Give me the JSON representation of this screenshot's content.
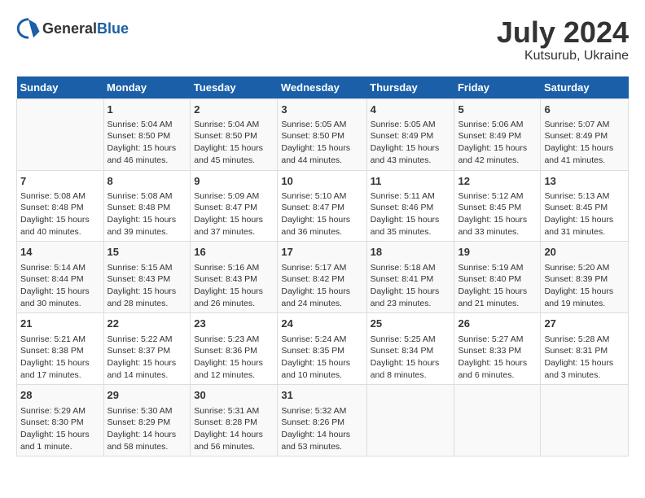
{
  "header": {
    "logo_general": "General",
    "logo_blue": "Blue",
    "month_year": "July 2024",
    "location": "Kutsurub, Ukraine"
  },
  "days_of_week": [
    "Sunday",
    "Monday",
    "Tuesday",
    "Wednesday",
    "Thursday",
    "Friday",
    "Saturday"
  ],
  "weeks": [
    [
      {
        "day": "",
        "info": ""
      },
      {
        "day": "1",
        "info": "Sunrise: 5:04 AM\nSunset: 8:50 PM\nDaylight: 15 hours\nand 46 minutes."
      },
      {
        "day": "2",
        "info": "Sunrise: 5:04 AM\nSunset: 8:50 PM\nDaylight: 15 hours\nand 45 minutes."
      },
      {
        "day": "3",
        "info": "Sunrise: 5:05 AM\nSunset: 8:50 PM\nDaylight: 15 hours\nand 44 minutes."
      },
      {
        "day": "4",
        "info": "Sunrise: 5:05 AM\nSunset: 8:49 PM\nDaylight: 15 hours\nand 43 minutes."
      },
      {
        "day": "5",
        "info": "Sunrise: 5:06 AM\nSunset: 8:49 PM\nDaylight: 15 hours\nand 42 minutes."
      },
      {
        "day": "6",
        "info": "Sunrise: 5:07 AM\nSunset: 8:49 PM\nDaylight: 15 hours\nand 41 minutes."
      }
    ],
    [
      {
        "day": "7",
        "info": "Sunrise: 5:08 AM\nSunset: 8:48 PM\nDaylight: 15 hours\nand 40 minutes."
      },
      {
        "day": "8",
        "info": "Sunrise: 5:08 AM\nSunset: 8:48 PM\nDaylight: 15 hours\nand 39 minutes."
      },
      {
        "day": "9",
        "info": "Sunrise: 5:09 AM\nSunset: 8:47 PM\nDaylight: 15 hours\nand 37 minutes."
      },
      {
        "day": "10",
        "info": "Sunrise: 5:10 AM\nSunset: 8:47 PM\nDaylight: 15 hours\nand 36 minutes."
      },
      {
        "day": "11",
        "info": "Sunrise: 5:11 AM\nSunset: 8:46 PM\nDaylight: 15 hours\nand 35 minutes."
      },
      {
        "day": "12",
        "info": "Sunrise: 5:12 AM\nSunset: 8:45 PM\nDaylight: 15 hours\nand 33 minutes."
      },
      {
        "day": "13",
        "info": "Sunrise: 5:13 AM\nSunset: 8:45 PM\nDaylight: 15 hours\nand 31 minutes."
      }
    ],
    [
      {
        "day": "14",
        "info": "Sunrise: 5:14 AM\nSunset: 8:44 PM\nDaylight: 15 hours\nand 30 minutes."
      },
      {
        "day": "15",
        "info": "Sunrise: 5:15 AM\nSunset: 8:43 PM\nDaylight: 15 hours\nand 28 minutes."
      },
      {
        "day": "16",
        "info": "Sunrise: 5:16 AM\nSunset: 8:43 PM\nDaylight: 15 hours\nand 26 minutes."
      },
      {
        "day": "17",
        "info": "Sunrise: 5:17 AM\nSunset: 8:42 PM\nDaylight: 15 hours\nand 24 minutes."
      },
      {
        "day": "18",
        "info": "Sunrise: 5:18 AM\nSunset: 8:41 PM\nDaylight: 15 hours\nand 23 minutes."
      },
      {
        "day": "19",
        "info": "Sunrise: 5:19 AM\nSunset: 8:40 PM\nDaylight: 15 hours\nand 21 minutes."
      },
      {
        "day": "20",
        "info": "Sunrise: 5:20 AM\nSunset: 8:39 PM\nDaylight: 15 hours\nand 19 minutes."
      }
    ],
    [
      {
        "day": "21",
        "info": "Sunrise: 5:21 AM\nSunset: 8:38 PM\nDaylight: 15 hours\nand 17 minutes."
      },
      {
        "day": "22",
        "info": "Sunrise: 5:22 AM\nSunset: 8:37 PM\nDaylight: 15 hours\nand 14 minutes."
      },
      {
        "day": "23",
        "info": "Sunrise: 5:23 AM\nSunset: 8:36 PM\nDaylight: 15 hours\nand 12 minutes."
      },
      {
        "day": "24",
        "info": "Sunrise: 5:24 AM\nSunset: 8:35 PM\nDaylight: 15 hours\nand 10 minutes."
      },
      {
        "day": "25",
        "info": "Sunrise: 5:25 AM\nSunset: 8:34 PM\nDaylight: 15 hours\nand 8 minutes."
      },
      {
        "day": "26",
        "info": "Sunrise: 5:27 AM\nSunset: 8:33 PM\nDaylight: 15 hours\nand 6 minutes."
      },
      {
        "day": "27",
        "info": "Sunrise: 5:28 AM\nSunset: 8:31 PM\nDaylight: 15 hours\nand 3 minutes."
      }
    ],
    [
      {
        "day": "28",
        "info": "Sunrise: 5:29 AM\nSunset: 8:30 PM\nDaylight: 15 hours\nand 1 minute."
      },
      {
        "day": "29",
        "info": "Sunrise: 5:30 AM\nSunset: 8:29 PM\nDaylight: 14 hours\nand 58 minutes."
      },
      {
        "day": "30",
        "info": "Sunrise: 5:31 AM\nSunset: 8:28 PM\nDaylight: 14 hours\nand 56 minutes."
      },
      {
        "day": "31",
        "info": "Sunrise: 5:32 AM\nSunset: 8:26 PM\nDaylight: 14 hours\nand 53 minutes."
      },
      {
        "day": "",
        "info": ""
      },
      {
        "day": "",
        "info": ""
      },
      {
        "day": "",
        "info": ""
      }
    ]
  ]
}
